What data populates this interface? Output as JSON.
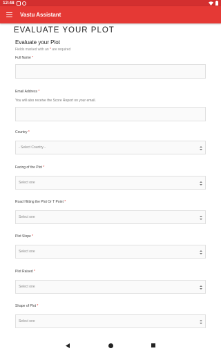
{
  "statusbar": {
    "time": "12:48"
  },
  "appbar": {
    "title": "Vastu Assistant"
  },
  "page": {
    "heading": "EVALUATE YOUR PLOT",
    "form_title": "Evaluate your Plot",
    "required_note_prefix": "Fields marked with an ",
    "required_star": "*",
    "required_note_suffix": " are required"
  },
  "fields": {
    "full_name": {
      "label": "Full Name"
    },
    "email": {
      "label": "Email Address",
      "hint": "You will also receive the Score Report on your email."
    },
    "country": {
      "label": "Country",
      "selected": "Select Country"
    },
    "facing": {
      "label": "Facing of the Plot",
      "selected": "Select one"
    },
    "road_hitting": {
      "label": "Road Hitting the Plot Or T Point",
      "selected": "Select one"
    },
    "slope": {
      "label": "Plot Slope",
      "selected": "Select one"
    },
    "raised": {
      "label": "Plot Raised",
      "selected": "Select one"
    },
    "shape": {
      "label": "Shape of Plot",
      "selected": "Select one"
    }
  },
  "colors": {
    "accent": "#e53935",
    "statusbar": "#d32f2f"
  },
  "icons": [
    "menu-icon",
    "wifi-icon",
    "battery-icon",
    "back-icon",
    "home-icon",
    "recents-icon",
    "select-arrows-icon"
  ]
}
